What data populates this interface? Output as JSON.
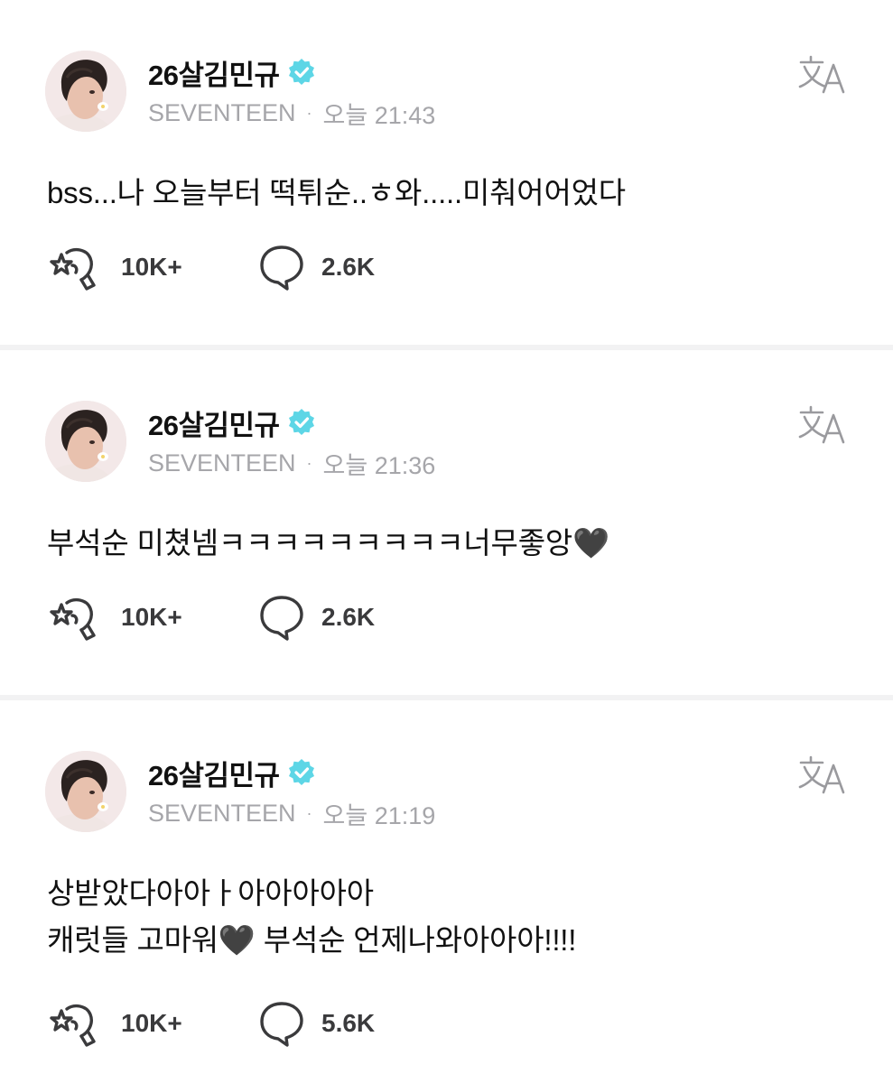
{
  "colors": {
    "verified_badge": "#5dd6e6",
    "meta_text": "#a6a6aa",
    "divider": "#f2f2f3",
    "black_heart": "#111111"
  },
  "icons": {
    "verified": "verified-badge-icon",
    "translate": "translate-icon",
    "reaction": "star-hand-reaction-icon",
    "comment": "speech-bubble-icon",
    "avatar": "profile-photo"
  },
  "posts": [
    {
      "author": "26살김민규",
      "group": "SEVENTEEN",
      "separator": "·",
      "time": "오늘 21:43",
      "text": "bss...나 오늘부터 떡튀순..ㅎ와.....미춰어어었다",
      "reactions": "10K+",
      "comments": "2.6K"
    },
    {
      "author": "26살김민규",
      "group": "SEVENTEEN",
      "separator": "·",
      "time": "오늘 21:36",
      "text": "부석순 미쳤넴ㅋㅋㅋㅋㅋㅋㅋㅋㅋ너무좋앙🖤",
      "reactions": "10K+",
      "comments": "2.6K"
    },
    {
      "author": "26살김민규",
      "group": "SEVENTEEN",
      "separator": "·",
      "time": "오늘 21:19",
      "text": "상받았다아아ㅏ아아아아아\n캐럿들 고마워🖤 부석순 언제나와아아아!!!!",
      "reactions": "10K+",
      "comments": "5.6K"
    }
  ]
}
